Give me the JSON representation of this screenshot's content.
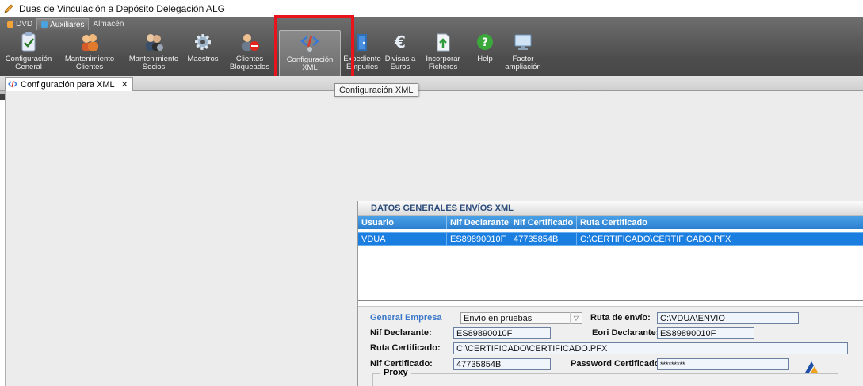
{
  "window": {
    "title": "Duas de Vinculación a Depósito Delegación ALG"
  },
  "ribbon_tabs": [
    {
      "label": "DVD"
    },
    {
      "label": "Auxiliares"
    },
    {
      "label": "Almacén"
    }
  ],
  "toolbar": [
    {
      "line1": "Configuración",
      "line2": "General",
      "icon": "clipboard-icon"
    },
    {
      "line1": "Mantenimiento",
      "line2": "Clientes",
      "icon": "users-icon"
    },
    {
      "line1": "Mantenimiento",
      "line2": "Socios",
      "icon": "partners-icon"
    },
    {
      "line1": "Maestros",
      "line2": "",
      "icon": "gear-icon"
    },
    {
      "line1": "Clientes",
      "line2": "Bloqueados",
      "icon": "blocked-user-icon"
    },
    {
      "line1": "Configuración",
      "line2": "XML",
      "icon": "xml-config-icon"
    },
    {
      "line1": "Expediente",
      "line2": "Empuries",
      "icon": "door-icon"
    },
    {
      "line1": "Divisas a",
      "line2": "Euros",
      "icon": "euro-icon"
    },
    {
      "line1": "Incorporar",
      "line2": "Ficheros",
      "icon": "upload-file-icon"
    },
    {
      "line1": "Help",
      "line2": "",
      "icon": "help-icon"
    },
    {
      "line1": "Factor",
      "line2": "ampliación",
      "icon": "monitor-zoom-icon"
    }
  ],
  "tooltip": "Configuración XML",
  "doc_tab": {
    "label": "Configuración para XML",
    "close": "✕"
  },
  "panel": {
    "title": "DATOS GENERALES ENVÍOS XML",
    "columns": [
      "Usuario",
      "Nif Declarante",
      "Nif Certificado",
      "Ruta Certificado"
    ],
    "rows": [
      [
        "VDUA",
        "ES89890010F",
        "47735854B",
        "C:\\CERTIFICADO\\CERTIFICADO.PFX"
      ]
    ]
  },
  "form": {
    "section_label": "General Empresa",
    "envio_select": "Envío en pruebas",
    "ruta_envio_label": "Ruta de envío:",
    "ruta_envio_value": "C:\\VDUA\\ENVIO",
    "nif_declarante_label": "Nif Declarante:",
    "nif_declarante_value": "ES89890010F",
    "eori_label": "Eori Declarante:",
    "eori_value": "ES89890010F",
    "ruta_cert_label": "Ruta Certificado:",
    "ruta_cert_value": "C:\\CERTIFICADO\\CERTIFICADO.PFX",
    "nif_cert_label": "Nif Certificado:",
    "nif_cert_value": "47735854B",
    "password_label": "Password Certificado:",
    "password_value": "*********",
    "proxy_label": "Proxy"
  },
  "colors": {
    "highlight": "#e8131b",
    "grid_selected": "#1a7de0",
    "section_label": "#3a77c8"
  }
}
